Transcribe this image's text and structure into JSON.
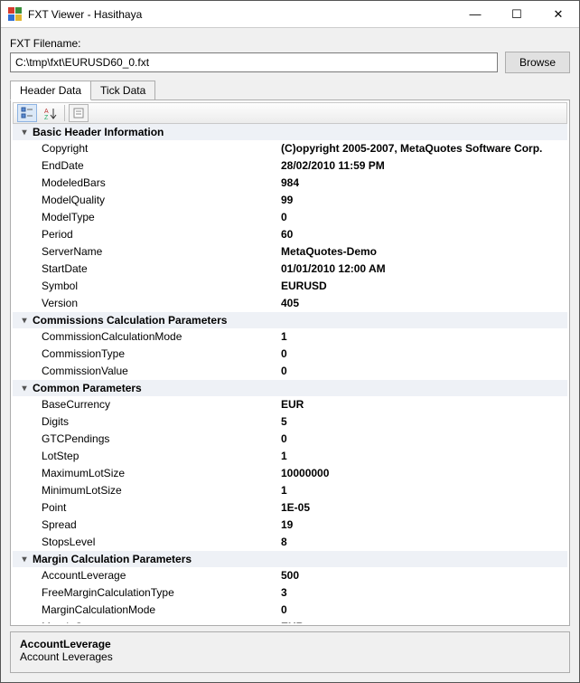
{
  "window": {
    "title": "FXT Viewer - Hasithaya"
  },
  "winbuttons": {
    "min": "—",
    "max": "☐",
    "close": "✕"
  },
  "filename_label": "FXT Filename:",
  "filename_value": "C:\\tmp\\fxt\\EURUSD60_0.fxt",
  "browse_label": "Browse",
  "tabs": {
    "header": "Header Data",
    "tick": "Tick Data"
  },
  "categories": [
    {
      "title": "Basic Header Information",
      "rows": [
        {
          "name": "Copyright",
          "value": "(C)opyright 2005-2007, MetaQuotes Software Corp."
        },
        {
          "name": "EndDate",
          "value": "28/02/2010 11:59 PM"
        },
        {
          "name": "ModeledBars",
          "value": "984"
        },
        {
          "name": "ModelQuality",
          "value": "99"
        },
        {
          "name": "ModelType",
          "value": "0"
        },
        {
          "name": "Period",
          "value": "60"
        },
        {
          "name": "ServerName",
          "value": "MetaQuotes-Demo"
        },
        {
          "name": "StartDate",
          "value": "01/01/2010 12:00 AM"
        },
        {
          "name": "Symbol",
          "value": "EURUSD"
        },
        {
          "name": "Version",
          "value": "405"
        }
      ]
    },
    {
      "title": "Commissions Calculation Parameters",
      "rows": [
        {
          "name": "CommissionCalculationMode",
          "value": "1"
        },
        {
          "name": "CommissionType",
          "value": "0"
        },
        {
          "name": "CommissionValue",
          "value": "0"
        }
      ]
    },
    {
      "title": "Common Parameters",
      "rows": [
        {
          "name": "BaseCurrency",
          "value": "EUR"
        },
        {
          "name": "Digits",
          "value": "5"
        },
        {
          "name": "GTCPendings",
          "value": "0"
        },
        {
          "name": "LotStep",
          "value": "1"
        },
        {
          "name": "MaximumLotSize",
          "value": "10000000"
        },
        {
          "name": "MinimumLotSize",
          "value": "1"
        },
        {
          "name": "Point",
          "value": "1E-05"
        },
        {
          "name": "Spread",
          "value": "19"
        },
        {
          "name": "StopsLevel",
          "value": "8"
        }
      ]
    },
    {
      "title": "Margin Calculation Parameters",
      "rows": [
        {
          "name": "AccountLeverage",
          "value": "500"
        },
        {
          "name": "FreeMarginCalculationType",
          "value": "3"
        },
        {
          "name": "MarginCalculationMode",
          "value": "0"
        },
        {
          "name": "MarginCurrency",
          "value": "EUR"
        }
      ]
    }
  ],
  "description": {
    "title": "AccountLeverage",
    "text": "Account Leverages"
  }
}
